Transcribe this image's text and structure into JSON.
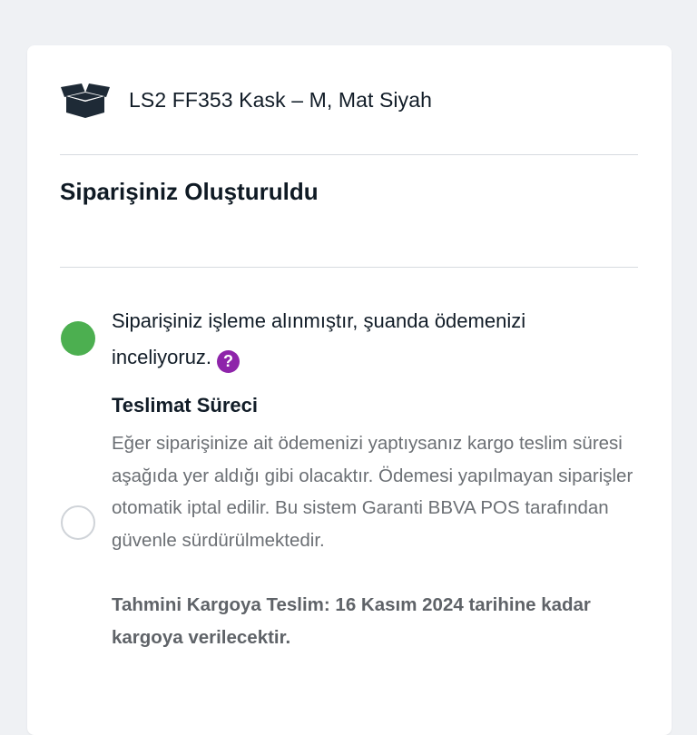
{
  "product": {
    "icon": "box-open-icon",
    "name": "LS2 FF353 Kask – M, Mat Siyah"
  },
  "order": {
    "title": "Siparişiniz Oluşturuldu"
  },
  "steps": [
    {
      "status": "done",
      "color": "#4caf50",
      "text": "Siparişiniz işleme alınmıştır, şuanda ödemenizi inceliyoruz.",
      "help_icon": "question-circle-icon",
      "help_color": "#8e24aa"
    },
    {
      "status": "pending",
      "title": "Teslimat Süreci",
      "description": "Eğer siparişinize ait ödemenizi yaptıysanız kargo teslim süresi aşağıda yer aldığı gibi olacaktır. Ödemesi yapılmayan siparişler otomatik iptal edilir. Bu sistem Garanti BBVA POS tarafından güvenle sürdürülmektedir.",
      "estimate": "Tahmini Kargoya Teslim: 16 Kasım 2024 tarihine kadar kargoya verilecektir."
    }
  ]
}
